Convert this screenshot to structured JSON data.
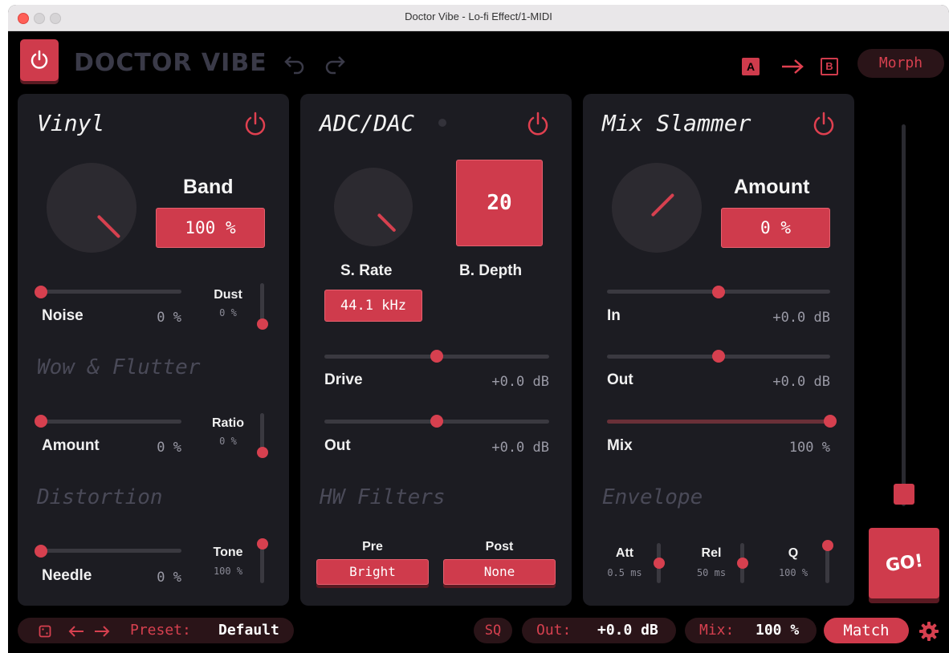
{
  "window": {
    "title": "Doctor Vibe - Lo-fi Effect/1-MIDI"
  },
  "header": {
    "brand": "DOCTOR VIBE",
    "ab_a": "A",
    "ab_b": "B",
    "morph_label": "Morph"
  },
  "vinyl": {
    "title": "Vinyl",
    "band_label": "Band",
    "band_value": "100 %",
    "noise_label": "Noise",
    "noise_value": "0 %",
    "dust_label": "Dust",
    "dust_value": "0 %",
    "wow_title": "Wow & Flutter",
    "amount_label": "Amount",
    "amount_value": "0 %",
    "ratio_label": "Ratio",
    "ratio_value": "0 %",
    "distortion_title": "Distortion",
    "needle_label": "Needle",
    "needle_value": "0 %",
    "tone_label": "Tone",
    "tone_value": "100 %"
  },
  "adc": {
    "title": "ADC/DAC",
    "depth_value": "20",
    "srate_label": "S. Rate",
    "bdepth_label": "B. Depth",
    "srate_value": "44.1 kHz",
    "drive_label": "Drive",
    "drive_value": "+0.0 dB",
    "out_label": "Out",
    "out_value": "+0.0 dB",
    "hw_title": "HW Filters",
    "pre_label": "Pre",
    "pre_value": "Bright",
    "post_label": "Post",
    "post_value": "None"
  },
  "slammer": {
    "title": "Mix Slammer",
    "amount_label": "Amount",
    "amount_value": "0 %",
    "in_label": "In",
    "in_value": "+0.0 dB",
    "out_label": "Out",
    "out_value": "+0.0 dB",
    "mix_label": "Mix",
    "mix_value": "100 %",
    "envelope_title": "Envelope",
    "att_label": "Att",
    "att_value": "0.5 ms",
    "rel_label": "Rel",
    "rel_value": "50 ms",
    "q_label": "Q",
    "q_value": "100 %"
  },
  "go_label": "GO!",
  "footer": {
    "preset_prefix": "Preset:",
    "preset_name": "Default",
    "sq_label": "SQ",
    "out_prefix": "Out:",
    "out_value": "+0.0 dB",
    "mix_prefix": "Mix:",
    "mix_value": "100 %",
    "match_label": "Match"
  },
  "colors": {
    "accent": "#cf3b4c",
    "panel": "#1c1c22",
    "background": "#000000"
  }
}
